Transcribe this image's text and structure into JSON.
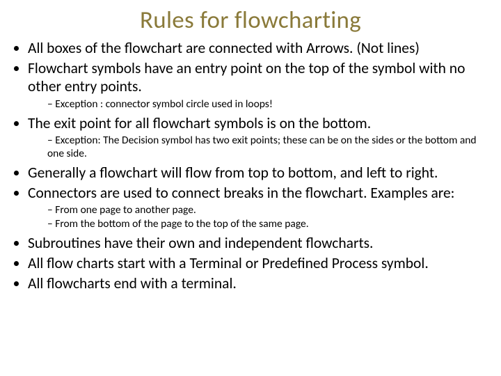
{
  "title": "Rules for flowcharting",
  "items": [
    {
      "text": "All boxes of the flowchart are connected with Arrows. (Not lines)"
    },
    {
      "text": "Flowchart symbols have an entry point on the top of the symbol with no other entry points.",
      "sub": [
        "Exception : connector symbol circle used in loops!"
      ]
    },
    {
      "text": "The exit point for all flowchart symbols is on the bottom.",
      "sub": [
        "Exception: The Decision symbol has two exit points; these can be on the sides or the bottom and one side."
      ]
    },
    {
      "text": "Generally a flowchart will flow from top to bottom, and left to right."
    },
    {
      "text": "Connectors are used to connect breaks in the flowchart. Examples are:",
      "sub": [
        "From one page to another page.",
        "From the bottom of the page to the top of the same page."
      ]
    },
    {
      "text": "Subroutines have their own and independent flowcharts."
    },
    {
      "text": "All flow charts start with a Terminal or Predefined Process symbol."
    },
    {
      "text": "All flowcharts end with a terminal."
    }
  ]
}
